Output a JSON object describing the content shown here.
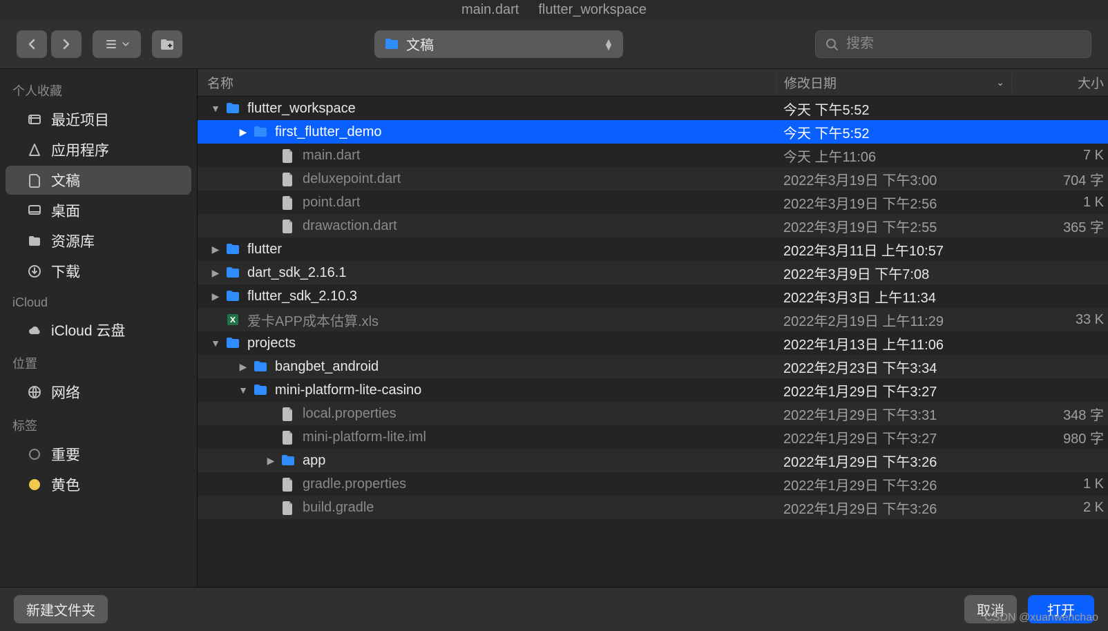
{
  "title_left": "main.dart",
  "title_right": "flutter_workspace",
  "path_selector": {
    "label": "文稿"
  },
  "search": {
    "placeholder": "搜索"
  },
  "columns": {
    "name": "名称",
    "date": "修改日期",
    "size": "大小"
  },
  "sidebar": {
    "sections": [
      {
        "title": "个人收藏",
        "items": [
          {
            "icon": "clock",
            "label": "最近项目"
          },
          {
            "icon": "apps",
            "label": "应用程序"
          },
          {
            "icon": "doc",
            "label": "文稿",
            "selected": true
          },
          {
            "icon": "desktop",
            "label": "桌面"
          },
          {
            "icon": "library",
            "label": "资源库"
          },
          {
            "icon": "download",
            "label": "下载"
          }
        ]
      },
      {
        "title": "iCloud",
        "items": [
          {
            "icon": "cloud",
            "label": "iCloud 云盘"
          }
        ]
      },
      {
        "title": "位置",
        "items": [
          {
            "icon": "network",
            "label": "网络"
          }
        ]
      },
      {
        "title": "标签",
        "items": [
          {
            "icon": "tag-outline",
            "label": "重要"
          },
          {
            "icon": "tag-yellow",
            "label": "黄色"
          }
        ]
      }
    ]
  },
  "rows": [
    {
      "indent": 0,
      "disclosure": "open",
      "kind": "folder",
      "name": "flutter_workspace",
      "date": "今天 下午5:52",
      "size": "",
      "dim": false
    },
    {
      "indent": 1,
      "disclosure": "closed",
      "kind": "folder",
      "name": "first_flutter_demo",
      "date": "今天 下午5:52",
      "size": "",
      "dim": false,
      "selected": true
    },
    {
      "indent": 2,
      "disclosure": "none",
      "kind": "file",
      "name": "main.dart",
      "date": "今天 上午11:06",
      "size": "7 K",
      "dim": true,
      "dimDate": true
    },
    {
      "indent": 2,
      "disclosure": "none",
      "kind": "file",
      "name": "deluxepoint.dart",
      "date": "2022年3月19日 下午3:00",
      "size": "704 字",
      "dim": true,
      "dimDate": true
    },
    {
      "indent": 2,
      "disclosure": "none",
      "kind": "file",
      "name": "point.dart",
      "date": "2022年3月19日 下午2:56",
      "size": "1 K",
      "dim": true,
      "dimDate": true
    },
    {
      "indent": 2,
      "disclosure": "none",
      "kind": "file",
      "name": "drawaction.dart",
      "date": "2022年3月19日 下午2:55",
      "size": "365 字",
      "dim": true,
      "dimDate": true
    },
    {
      "indent": 0,
      "disclosure": "closed",
      "kind": "folder",
      "name": "flutter",
      "date": "2022年3月11日 上午10:57",
      "size": "",
      "dim": false
    },
    {
      "indent": 0,
      "disclosure": "closed",
      "kind": "folder",
      "name": "dart_sdk_2.16.1",
      "date": "2022年3月9日 下午7:08",
      "size": "",
      "dim": false
    },
    {
      "indent": 0,
      "disclosure": "closed",
      "kind": "folder",
      "name": "flutter_sdk_2.10.3",
      "date": "2022年3月3日 上午11:34",
      "size": "",
      "dim": false
    },
    {
      "indent": 0,
      "disclosure": "none",
      "kind": "xls",
      "name": "爱卡APP成本估算.xls",
      "date": "2022年2月19日 上午11:29",
      "size": "33 K",
      "dim": true,
      "dimDate": true
    },
    {
      "indent": 0,
      "disclosure": "open",
      "kind": "folder",
      "name": "projects",
      "date": "2022年1月13日 上午11:06",
      "size": "",
      "dim": false
    },
    {
      "indent": 1,
      "disclosure": "closed",
      "kind": "folder",
      "name": "bangbet_android",
      "date": "2022年2月23日 下午3:34",
      "size": "",
      "dim": false
    },
    {
      "indent": 1,
      "disclosure": "open",
      "kind": "folder",
      "name": "mini-platform-lite-casino",
      "date": "2022年1月29日 下午3:27",
      "size": "",
      "dim": false
    },
    {
      "indent": 2,
      "disclosure": "none",
      "kind": "file",
      "name": "local.properties",
      "date": "2022年1月29日 下午3:31",
      "size": "348 字",
      "dim": true,
      "dimDate": true
    },
    {
      "indent": 2,
      "disclosure": "none",
      "kind": "file",
      "name": "mini-platform-lite.iml",
      "date": "2022年1月29日 下午3:27",
      "size": "980 字",
      "dim": true,
      "dimDate": true
    },
    {
      "indent": 2,
      "disclosure": "closed",
      "kind": "folder",
      "name": "app",
      "date": "2022年1月29日 下午3:26",
      "size": "",
      "dim": false
    },
    {
      "indent": 2,
      "disclosure": "none",
      "kind": "file",
      "name": "gradle.properties",
      "date": "2022年1月29日 下午3:26",
      "size": "1 K",
      "dim": true,
      "dimDate": true
    },
    {
      "indent": 2,
      "disclosure": "none",
      "kind": "file",
      "name": "build.gradle",
      "date": "2022年1月29日 下午3:26",
      "size": "2 K",
      "dim": true,
      "dimDate": true
    }
  ],
  "footer": {
    "new_folder": "新建文件夹",
    "cancel": "取消",
    "open": "打开"
  },
  "watermark": "CSDN @xuanwenchao"
}
